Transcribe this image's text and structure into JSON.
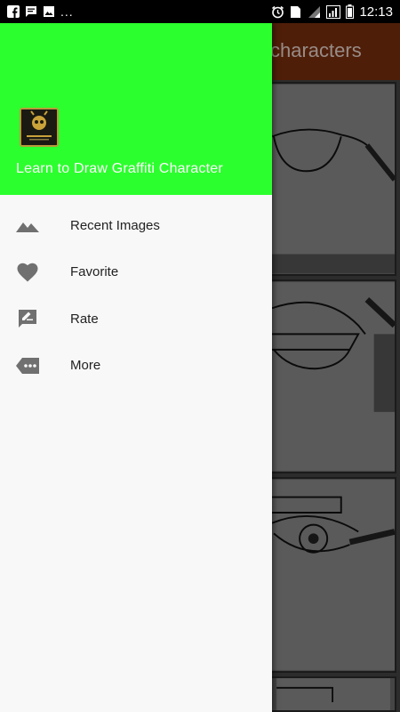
{
  "status_bar": {
    "left_icons": [
      "facebook-icon",
      "chat-icon",
      "image-icon"
    ],
    "overflow": "...",
    "right_icons": [
      "alarm-icon",
      "sim-2-icon",
      "signal-icon",
      "signal-bars-icon",
      "battery-icon"
    ],
    "sim_label": "2",
    "time": "12:13"
  },
  "app": {
    "toolbar_title": "characters",
    "toolbar_color": "#7a2e0f",
    "thumbnails": [
      "eye-sketch-1",
      "eye-sketch-2",
      "eye-sketch-3",
      "eye-sketch-4"
    ]
  },
  "drawer": {
    "header_color": "#2cff2e",
    "app_name": "Learn to Draw Graffiti Character",
    "items": [
      {
        "label": "Recent Images",
        "icon": "landscape-icon"
      },
      {
        "label": "Favorite",
        "icon": "heart-icon"
      },
      {
        "label": "Rate",
        "icon": "rate-review-icon"
      },
      {
        "label": "More",
        "icon": "more-tag-icon"
      }
    ]
  }
}
